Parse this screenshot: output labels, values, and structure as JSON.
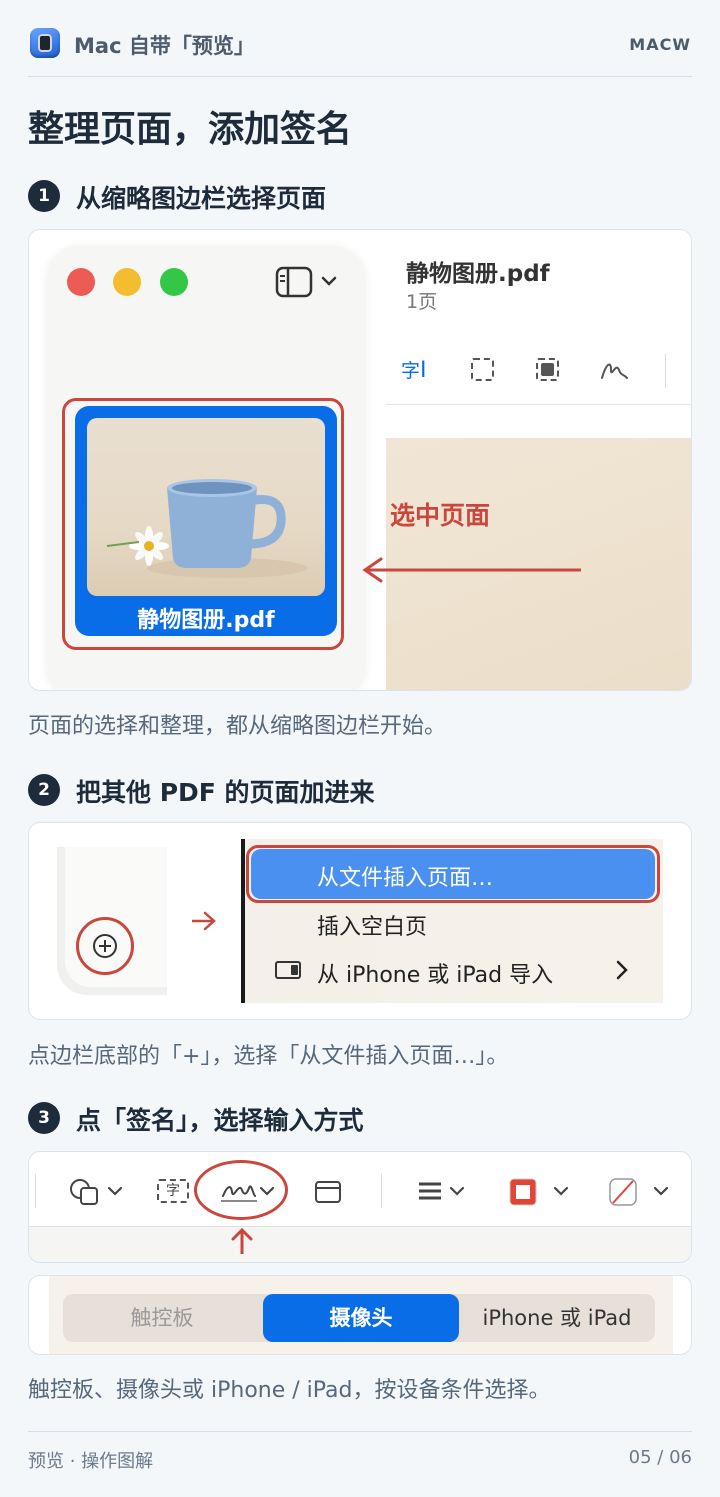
{
  "header": {
    "title": "Mac 自带「预览」",
    "brand": "MACW"
  },
  "page_title": "整理页面，添加签名",
  "steps": [
    {
      "num": "1",
      "title": "从缩略图边栏选择页面",
      "doc_title": "静物图册.pdf",
      "doc_pages": "1页",
      "toolbar_text_icon": "字",
      "thumb_label": "静物图册.pdf",
      "annotation": "选中页面",
      "caption": "页面的选择和整理，都从缩略图边栏开始。"
    },
    {
      "num": "2",
      "title": "把其他 PDF 的页面加进来",
      "menu": [
        "从文件插入页面…",
        "插入空白页",
        "从 iPhone 或 iPad 导入"
      ],
      "caption": "点边栏底部的「+」，选择「从文件插入页面…」。"
    },
    {
      "num": "3",
      "title": "点「签名」，选择输入方式",
      "toolbar_text_icon": "字",
      "segments": [
        "触控板",
        "摄像头",
        "iPhone 或 iPad"
      ],
      "selected_segment": "摄像头",
      "caption": "触控板、摄像头或 iPhone / iPad，按设备条件选择。"
    }
  ],
  "footer": {
    "left": "预览 · 操作图解",
    "right": "05 / 06"
  },
  "colors": {
    "accent": "#0a6de8",
    "annotation_red": "#c9473d",
    "dark": "#1d2b3a"
  }
}
